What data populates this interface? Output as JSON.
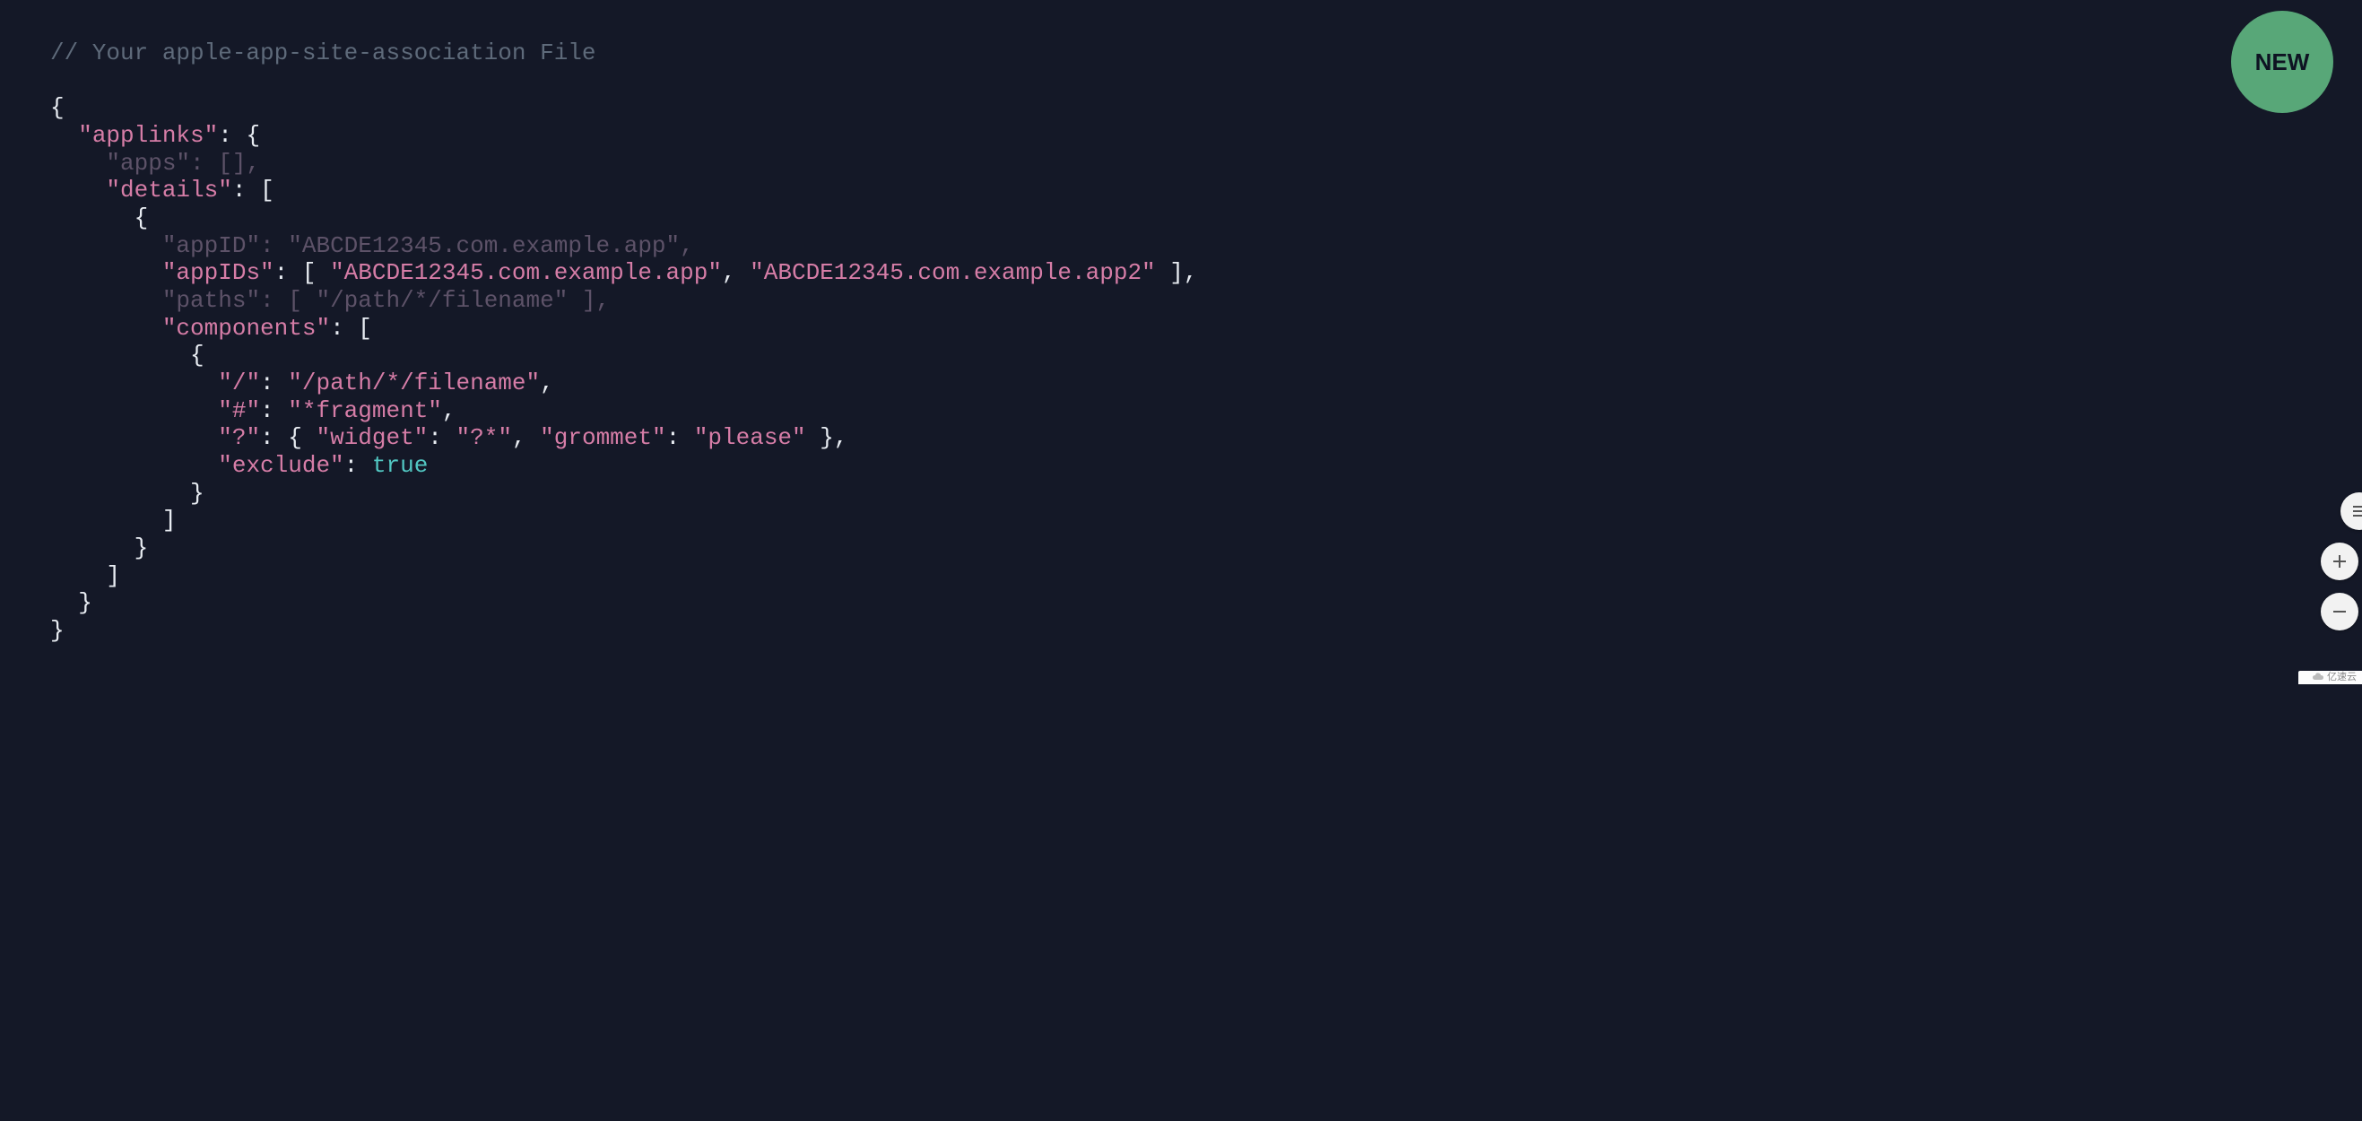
{
  "badge": {
    "label": "NEW"
  },
  "watermark": {
    "text": "亿速云"
  },
  "code": {
    "comment": "// Your apple-app-site-association File",
    "applinks_key": "\"applinks\"",
    "apps_key": "\"apps\"",
    "apps_value": "[]",
    "details_key": "\"details\"",
    "appID_key": "\"appID\"",
    "appID_value": "\"ABCDE12345.com.example.app\"",
    "appIDs_key": "\"appIDs\"",
    "appIDs_v1": "\"ABCDE12345.com.example.app\"",
    "appIDs_v2": "\"ABCDE12345.com.example.app2\"",
    "paths_key": "\"paths\"",
    "paths_value": "\"/path/*/filename\"",
    "components_key": "\"components\"",
    "slash_key": "\"/\"",
    "slash_value": "\"/path/*/filename\"",
    "hash_key": "\"#\"",
    "hash_value": "\"*fragment\"",
    "q_key": "\"?\"",
    "widget_key": "\"widget\"",
    "widget_value": "\"?*\"",
    "grommet_key": "\"grommet\"",
    "grommet_value": "\"please\"",
    "exclude_key": "\"exclude\"",
    "exclude_value": "true"
  }
}
